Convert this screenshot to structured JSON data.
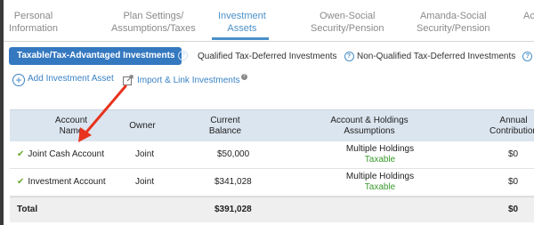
{
  "top_tabs": [
    {
      "label": "Personal\nInformation"
    },
    {
      "label": "Plan Settings/\nAssumptions/Taxes"
    },
    {
      "label": "Investment\nAssets"
    },
    {
      "label": "Owen-Social\nSecurity/Pension"
    },
    {
      "label": "Amanda-Social\nSecurity/Pension"
    },
    {
      "label": "Ac"
    }
  ],
  "sub_tabs": {
    "taxable": "Taxable/Tax-Advantaged Investments",
    "qualified": "Qualified Tax-Deferred Investments",
    "nonqualified": "Non-Qualified Tax-Deferred Investments"
  },
  "actions": {
    "add": "Add Investment Asset",
    "import": "Import & Link Investments"
  },
  "table": {
    "headers": {
      "account_name": "Account\nName",
      "owner": "Owner",
      "balance": "Current\nBalance",
      "assumptions": "Account & Holdings\nAssumptions",
      "annual": "Annual\nContribution"
    },
    "rows": [
      {
        "name": "Joint Cash Account",
        "owner": "Joint",
        "balance": "$50,000",
        "holdings": "Multiple Holdings",
        "tax": "Taxable",
        "annual": "$0"
      },
      {
        "name": "Investment Account",
        "owner": "Joint",
        "balance": "$341,028",
        "holdings": "Multiple Holdings",
        "tax": "Taxable",
        "annual": "$0"
      }
    ],
    "total": {
      "label": "Total",
      "balance": "$391,028",
      "annual": "$0"
    }
  },
  "colors": {
    "accent": "#3478c0",
    "arrow": "#e8321e",
    "taxable": "#3a9a2e"
  }
}
